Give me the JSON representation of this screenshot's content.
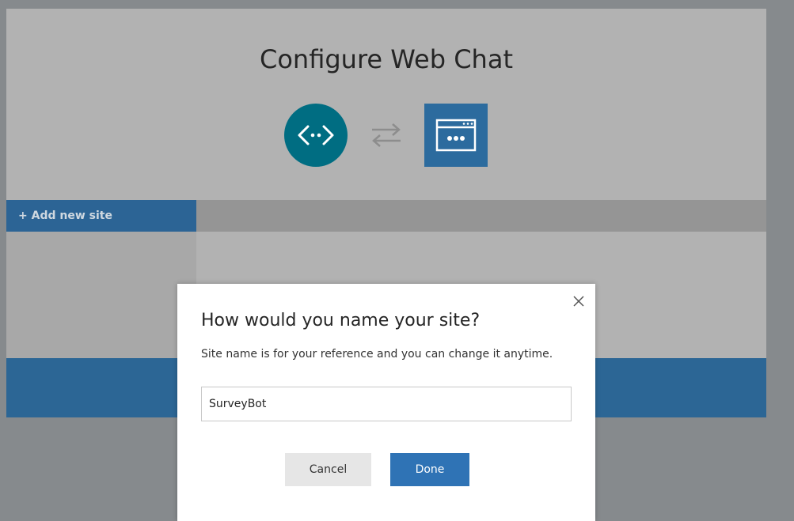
{
  "page": {
    "title": "Configure Web Chat"
  },
  "icons": {
    "bot": "code-icon",
    "swap": "swap-arrows-icon",
    "webchat": "browser-window-icon",
    "close": "close-icon"
  },
  "tabs": {
    "add_site_label": "+ Add new site"
  },
  "dialog": {
    "title": "How would you name your site?",
    "description": "Site name is for your reference and you can change it anytime.",
    "site_name_value": "SurveyBot",
    "cancel_label": "Cancel",
    "done_label": "Done"
  },
  "colors": {
    "accent": "#2f73b5",
    "bot_icon": "#006d82",
    "webchat_icon": "#2c6b9e"
  }
}
